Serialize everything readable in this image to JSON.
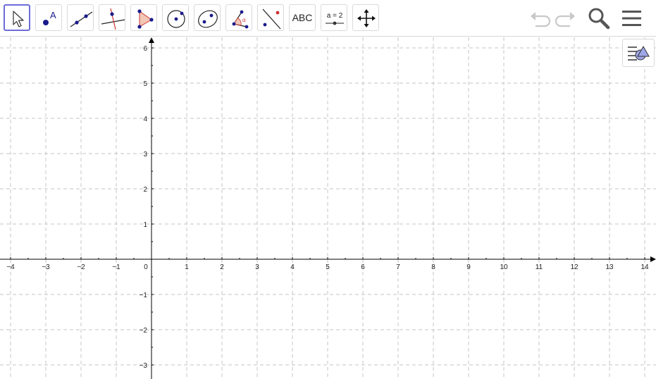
{
  "toolbar": {
    "tools": [
      {
        "name": "move-tool",
        "icon": "arrow-cursor-icon"
      },
      {
        "name": "point-tool",
        "icon": "point-icon",
        "label": "A"
      },
      {
        "name": "line-tool",
        "icon": "line-through-two-points-icon"
      },
      {
        "name": "perpendicular-line-tool",
        "icon": "perpendicular-line-icon"
      },
      {
        "name": "polygon-tool",
        "icon": "polygon-icon"
      },
      {
        "name": "circle-tool",
        "icon": "circle-with-center-icon"
      },
      {
        "name": "conic-tool",
        "icon": "ellipse-icon"
      },
      {
        "name": "angle-tool",
        "icon": "angle-icon",
        "label": "α"
      },
      {
        "name": "reflect-tool",
        "icon": "reflect-about-line-icon"
      },
      {
        "name": "text-tool",
        "icon": "text-icon",
        "label": "ABC"
      },
      {
        "name": "slider-tool",
        "icon": "slider-icon",
        "label": "a = 2"
      },
      {
        "name": "move-graphics-view-tool",
        "icon": "move-arrows-icon"
      }
    ],
    "right": [
      {
        "name": "undo-button",
        "icon": "undo-icon"
      },
      {
        "name": "redo-button",
        "icon": "redo-icon"
      },
      {
        "name": "search-button",
        "icon": "search-icon"
      },
      {
        "name": "menu-button",
        "icon": "hamburger-menu-icon"
      }
    ]
  },
  "graphics": {
    "x_ticks": [
      "−4",
      "−3",
      "−2",
      "−1",
      "0",
      "1",
      "2",
      "3",
      "4",
      "5",
      "6",
      "7",
      "8",
      "9",
      "10",
      "11",
      "12",
      "13",
      "14"
    ],
    "y_ticks_pos": [
      "1",
      "2",
      "3",
      "4",
      "5",
      "6"
    ],
    "y_ticks_neg": [
      "−1",
      "−2",
      "−3"
    ],
    "grid": true
  },
  "colors": {
    "selected_border": "#6c6cd9",
    "point": "#1a1a8c",
    "accent_red": "#cc3333",
    "polygon_fill": "#f2c7b6",
    "grid": "#bfbfbf",
    "axis": "#000000"
  }
}
